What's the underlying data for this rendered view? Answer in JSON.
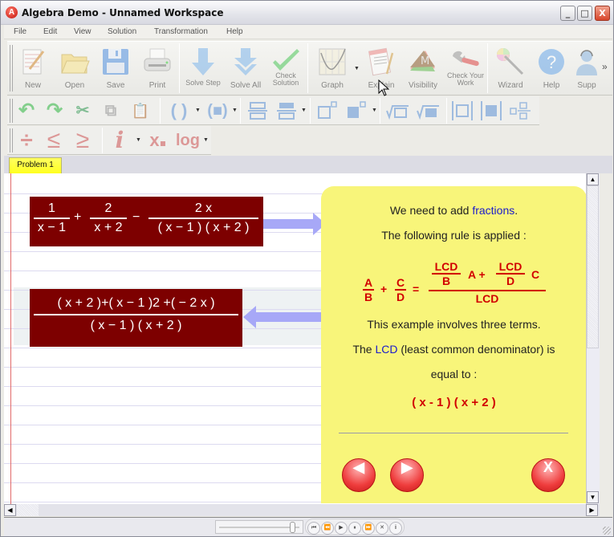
{
  "window": {
    "title": "Algebra Demo - Unnamed Workspace",
    "app_icon": "A",
    "controls": {
      "minimize": "_",
      "maximize": "□",
      "close": "X"
    }
  },
  "menu": [
    "File",
    "Edit",
    "View",
    "Solution",
    "Transformation",
    "Help"
  ],
  "toolbar_main": [
    {
      "label": "New",
      "icon": "new-document-icon"
    },
    {
      "label": "Open",
      "icon": "folder-open-icon"
    },
    {
      "label": "Save",
      "icon": "floppy-disk-icon"
    },
    {
      "label": "Print",
      "icon": "printer-icon"
    },
    {
      "label": "Solve Step",
      "icon": "arrow-down-icon"
    },
    {
      "label": "Solve All",
      "icon": "double-arrow-down-icon"
    },
    {
      "label": "Check Solution",
      "icon": "checkmark-icon"
    },
    {
      "label": "Graph",
      "icon": "graph-icon"
    },
    {
      "label": "Explain",
      "icon": "explain-document-icon"
    },
    {
      "label": "Visibility",
      "icon": "visibility-layers-icon"
    },
    {
      "label": "Check Your Work",
      "icon": "wrench-icon"
    },
    {
      "label": "Wizard",
      "icon": "magic-wand-icon"
    },
    {
      "label": "Help",
      "icon": "help-question-icon"
    },
    {
      "label": "Supp",
      "icon": "support-agent-icon"
    }
  ],
  "toolbar_overflow": "»",
  "toolbar_edit": {
    "undo": "↶",
    "redo": "↷",
    "cut": "✂",
    "copy": "⧉",
    "paste": "📋",
    "parens": "( )",
    "parens_filled": "(■)",
    "fraction": "▭/▭",
    "fraction_filled": "▬/▬",
    "power": "□°",
    "power_filled": "■°",
    "root": "√□",
    "root_filled": "√■",
    "abs": "|□|",
    "abs_filled": "|■|",
    "mixed": "□▫/▫"
  },
  "toolbar_ops": {
    "divide": "÷",
    "less_equal": "≤",
    "greater_equal": "≥",
    "imaginary": "i",
    "subscript": "x",
    "log": "log"
  },
  "tabs": [
    {
      "label": "Problem 1",
      "active": true
    }
  ],
  "expressions": {
    "original": {
      "term1": {
        "num": "1",
        "den": "x − 1"
      },
      "op1": "+",
      "term2": {
        "num": "2",
        "den": "x + 2"
      },
      "op2": "−",
      "term3": {
        "num": "2 x",
        "den": "( x − 1 ) ( x + 2 )"
      }
    },
    "result": {
      "num": "( x + 2 )+( x − 1 )2 +( − 2 x )",
      "den": "( x − 1 ) ( x + 2 )"
    }
  },
  "explanation": {
    "line1_prefix": "We need to add ",
    "line1_link": "fractions",
    "line1_suffix": ".",
    "line2": "The following rule is applied :",
    "rule": {
      "lhs1": {
        "num": "A",
        "den": "B"
      },
      "plus": "+",
      "lhs2": {
        "num": "C",
        "den": "D"
      },
      "eq": "=",
      "rhs_term1": {
        "num": "LCD",
        "den": "B"
      },
      "rhs_a": "A +",
      "rhs_term2": {
        "num": "LCD",
        "den": "D"
      },
      "rhs_c": "C",
      "rhs_den": "LCD"
    },
    "line3": "This example involves three terms.",
    "line4_prefix": "The ",
    "line4_link": "LCD",
    "line4_suffix": " (least common denominator) is",
    "line5": "equal to :",
    "lcd_value": "( x - 1 ) ( x + 2 )",
    "buttons": {
      "prev": "◀",
      "next": "▶",
      "close": "X"
    }
  },
  "scrollbars": {
    "up": "▲",
    "down": "▼",
    "left": "◀",
    "right": "▶"
  },
  "playback": {
    "slider_position": 0.9,
    "buttons": [
      "⏮",
      "⏪",
      "▶",
      "⏸",
      "⏩",
      "✕",
      "i"
    ]
  },
  "colors": {
    "expression_bg": "#7d0000",
    "panel_bg": "#f8f57a",
    "accent_red": "#d10000",
    "link_blue": "#1a1acc",
    "arrow": "#a7a8f7",
    "tab_active": "#ffff40"
  }
}
